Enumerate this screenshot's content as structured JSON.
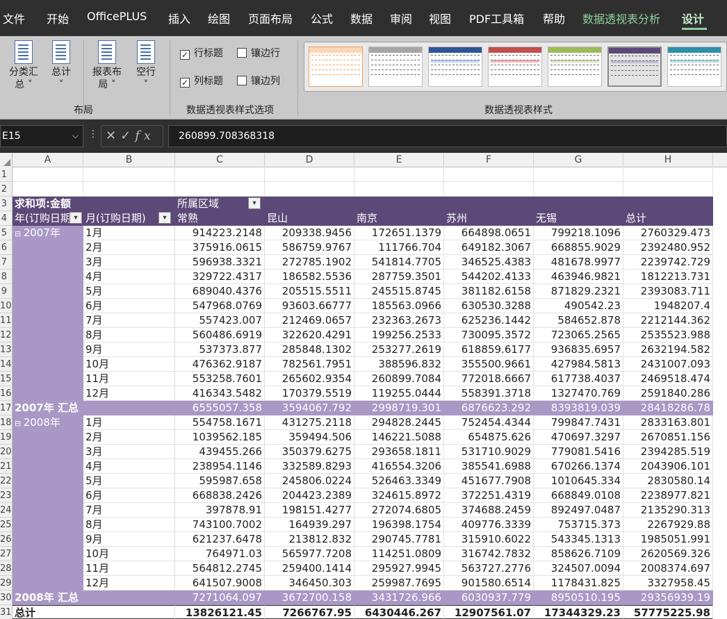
{
  "menu": {
    "items": [
      "文件",
      "开始",
      "OfficePLUS",
      "插入",
      "绘图",
      "页面布局",
      "公式",
      "数据",
      "审阅",
      "视图",
      "PDF工具箱",
      "帮助",
      "数据透视表分析",
      "设计"
    ]
  },
  "ribbon": {
    "layout": {
      "subtotal_line1": "分类汇",
      "subtotal_line2": "总",
      "grand_total": "总计",
      "report_layout_line1": "报表布",
      "report_layout_line2": "局",
      "blank_rows": "空行",
      "group_label": "布局"
    },
    "style_options": {
      "row_headers": "行标题",
      "col_headers": "列标题",
      "banded_rows": "镶边行",
      "banded_cols": "镶边列",
      "group_label": "数据透视表样式选项"
    },
    "styles": {
      "group_label": "数据透视表样式"
    }
  },
  "formula_bar": {
    "name_box": "E15",
    "formula": "260899.708368318"
  },
  "sheet": {
    "columns": [
      "A",
      "B",
      "C",
      "D",
      "E",
      "F",
      "G",
      "H"
    ],
    "row_numbers": [
      "1",
      "2",
      "3",
      "4",
      "5",
      "6",
      "7",
      "8",
      "9",
      "10",
      "11",
      "12",
      "13",
      "14",
      "15",
      "16",
      "17",
      "18",
      "19",
      "20",
      "21",
      "22",
      "23",
      "24",
      "25",
      "26",
      "27",
      "28",
      "29",
      "30",
      "31"
    ],
    "pivot": {
      "value_field": "求和项:金额",
      "column_field": "所属区域",
      "row_field_year": "年(订购日期)",
      "row_field_month": "月(订购日期)",
      "regions": [
        "常熟",
        "昆山",
        "南京",
        "苏州",
        "无锡",
        "总计"
      ],
      "y2007": {
        "label": "2007年",
        "months": [
          {
            "m": "1月",
            "v": [
              "914223.2148",
              "209338.9456",
              "172651.1379",
              "664898.0651",
              "799218.1096",
              "2760329.473"
            ]
          },
          {
            "m": "2月",
            "v": [
              "375916.0615",
              "586759.9767",
              "111766.704",
              "649182.3067",
              "668855.9029",
              "2392480.952"
            ]
          },
          {
            "m": "3月",
            "v": [
              "596938.3321",
              "272785.1902",
              "541814.7705",
              "346525.4383",
              "481678.9977",
              "2239742.729"
            ]
          },
          {
            "m": "4月",
            "v": [
              "329722.4317",
              "186582.5536",
              "287759.3501",
              "544202.4133",
              "463946.9821",
              "1812213.731"
            ]
          },
          {
            "m": "5月",
            "v": [
              "689040.4376",
              "205515.5511",
              "245515.8745",
              "381182.6158",
              "871829.2321",
              "2393083.711"
            ]
          },
          {
            "m": "6月",
            "v": [
              "547968.0769",
              "93603.66777",
              "185563.0966",
              "630530.3288",
              "490542.23",
              "1948207.4"
            ]
          },
          {
            "m": "7月",
            "v": [
              "557423.007",
              "212469.0657",
              "232363.2673",
              "625236.1442",
              "584652.878",
              "2212144.362"
            ]
          },
          {
            "m": "8月",
            "v": [
              "560486.6919",
              "322620.4291",
              "199256.2533",
              "730095.3572",
              "723065.2565",
              "2535523.988"
            ]
          },
          {
            "m": "9月",
            "v": [
              "537373.877",
              "285848.1302",
              "253277.2619",
              "618859.6177",
              "936835.6957",
              "2632194.582"
            ]
          },
          {
            "m": "10月",
            "v": [
              "476362.9187",
              "782561.7951",
              "388596.832",
              "355500.9661",
              "427984.5813",
              "2431007.093"
            ]
          },
          {
            "m": "11月",
            "v": [
              "553258.7601",
              "265602.9354",
              "260899.7084",
              "772018.6667",
              "617738.4037",
              "2469518.474"
            ]
          },
          {
            "m": "12月",
            "v": [
              "416343.5482",
              "170379.5519",
              "119255.0444",
              "558391.3718",
              "1327470.769",
              "2591840.286"
            ]
          }
        ],
        "subtotal_label": "2007年 汇总",
        "subtotal": [
          "6555057.358",
          "3594067.792",
          "2998719.301",
          "6876623.292",
          "8393819.039",
          "28418286.78"
        ]
      },
      "y2008": {
        "label": "2008年",
        "months": [
          {
            "m": "1月",
            "v": [
              "554758.1671",
              "431275.2118",
              "294828.2445",
              "752454.4344",
              "799847.7431",
              "2833163.801"
            ]
          },
          {
            "m": "2月",
            "v": [
              "1039562.185",
              "359494.506",
              "146221.5088",
              "654875.626",
              "470697.3297",
              "2670851.156"
            ]
          },
          {
            "m": "3月",
            "v": [
              "439455.266",
              "350379.6275",
              "293658.1811",
              "531710.9029",
              "779081.5416",
              "2394285.519"
            ]
          },
          {
            "m": "4月",
            "v": [
              "238954.1146",
              "332589.8293",
              "416554.3206",
              "385541.6988",
              "670266.1374",
              "2043906.101"
            ]
          },
          {
            "m": "5月",
            "v": [
              "595987.658",
              "245806.0224",
              "526463.3349",
              "451677.7908",
              "1010645.334",
              "2830580.14"
            ]
          },
          {
            "m": "6月",
            "v": [
              "668838.2426",
              "204423.2389",
              "324615.8972",
              "372251.4319",
              "668849.0108",
              "2238977.821"
            ]
          },
          {
            "m": "7月",
            "v": [
              "397878.91",
              "198151.4277",
              "272074.6805",
              "374688.2459",
              "892497.0487",
              "2135290.313"
            ]
          },
          {
            "m": "8月",
            "v": [
              "743100.7002",
              "164939.297",
              "196398.1754",
              "409776.3339",
              "753715.373",
              "2267929.88"
            ]
          },
          {
            "m": "9月",
            "v": [
              "621237.6478",
              "213812.832",
              "290745.7781",
              "315910.6022",
              "543345.1313",
              "1985051.991"
            ]
          },
          {
            "m": "10月",
            "v": [
              "764971.03",
              "565977.7208",
              "114251.0809",
              "316742.7832",
              "858626.7109",
              "2620569.326"
            ]
          },
          {
            "m": "11月",
            "v": [
              "564812.2745",
              "259400.1414",
              "295927.9945",
              "563727.2776",
              "324507.0094",
              "2008374.697"
            ]
          },
          {
            "m": "12月",
            "v": [
              "641507.9008",
              "346450.303",
              "259987.7695",
              "901580.6514",
              "1178431.825",
              "3327958.45"
            ]
          }
        ],
        "subtotal_label": "2008年 汇总",
        "subtotal": [
          "7271064.097",
          "3672700.158",
          "3431726.966",
          "6030937.779",
          "8950510.195",
          "29356939.19"
        ]
      },
      "grand_label": "总计",
      "grand": [
        "13826121.45",
        "7266767.95",
        "6430446.267",
        "12907561.07",
        "17344329.23",
        "57775225.98"
      ]
    }
  }
}
